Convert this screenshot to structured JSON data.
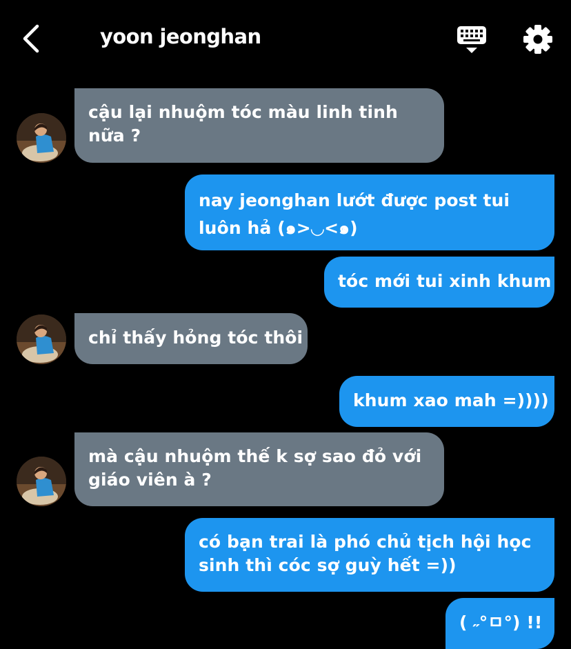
{
  "header": {
    "title": "yoon jeonghan",
    "back_icon": "chevron-left-icon",
    "keyboard_icon": "keyboard-icon",
    "settings_icon": "gear-icon"
  },
  "colors": {
    "background": "#000000",
    "incoming_bubble": "#6a7884",
    "outgoing_bubble": "#1d95ef",
    "text": "#ffffff"
  },
  "messages": [
    {
      "sender": "yoon jeonghan",
      "direction": "incoming",
      "lines": [
        "cậu lại nhuộm tóc màu linh tinh",
        "nữa ?"
      ]
    },
    {
      "sender": "me",
      "direction": "outgoing",
      "lines": [
        "nay jeonghan lướt được post tui",
        "luôn hả (๑>◡<๑)"
      ]
    },
    {
      "sender": "me",
      "direction": "outgoing",
      "lines": [
        "tóc mới tui xinh khum"
      ]
    },
    {
      "sender": "yoon jeonghan",
      "direction": "incoming",
      "lines": [
        "chỉ thấy hỏng tóc thôi"
      ]
    },
    {
      "sender": "me",
      "direction": "outgoing",
      "lines": [
        "khum xao mah =))))"
      ]
    },
    {
      "sender": "yoon jeonghan",
      "direction": "incoming",
      "lines": [
        "mà cậu nhuộm thế k sợ sao đỏ với",
        "giáo viên à ?"
      ]
    },
    {
      "sender": "me",
      "direction": "outgoing",
      "lines": [
        "có bạn trai là phó chủ tịch hội học",
        "sinh thì cóc sợ guỳ hết =))"
      ]
    },
    {
      "sender": "me",
      "direction": "outgoing",
      "lines": [
        "( ˶°ㅁ°) !!"
      ]
    }
  ]
}
